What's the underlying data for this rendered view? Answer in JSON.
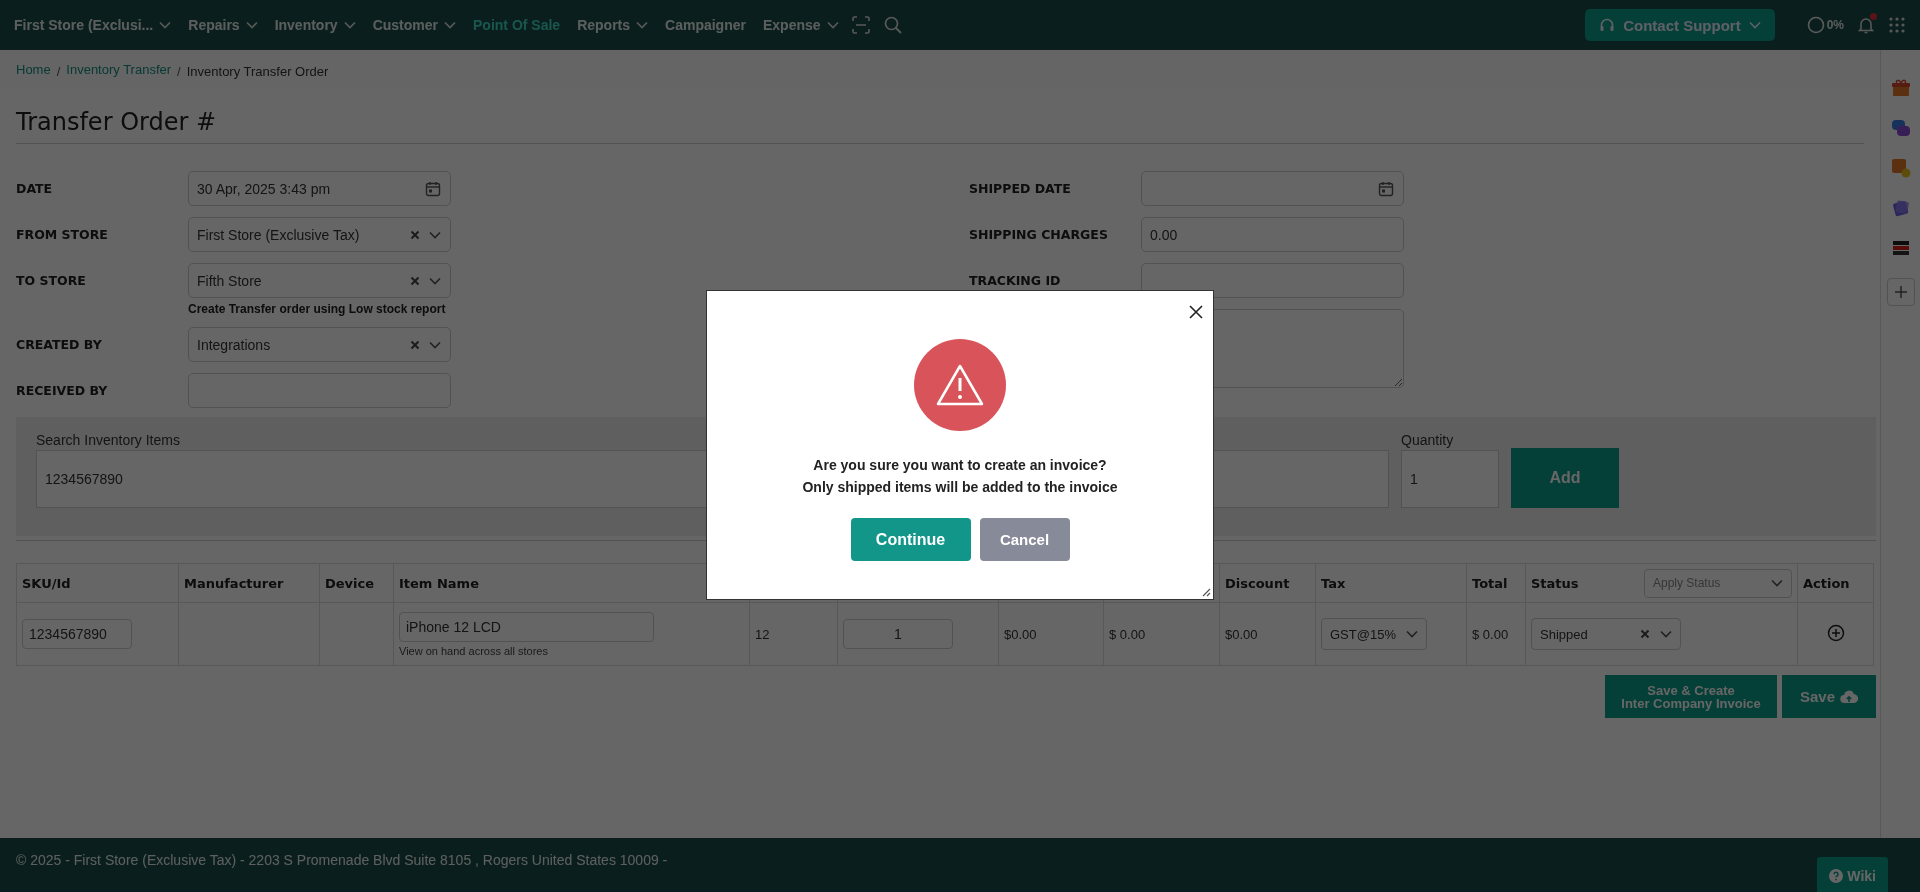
{
  "topbar": {
    "nav": [
      {
        "label": "First Store (Exclusi...",
        "dropdown": true,
        "selected": false
      },
      {
        "label": "Repairs",
        "dropdown": true,
        "selected": false
      },
      {
        "label": "Inventory",
        "dropdown": true,
        "selected": false
      },
      {
        "label": "Customer",
        "dropdown": true,
        "selected": false
      },
      {
        "label": "Point Of Sale",
        "dropdown": false,
        "selected": true
      },
      {
        "label": "Reports",
        "dropdown": true,
        "selected": false
      },
      {
        "label": "Campaigner",
        "dropdown": false,
        "selected": false
      },
      {
        "label": "Expense",
        "dropdown": true,
        "selected": false
      }
    ],
    "contact_support": "Contact Support",
    "progress": "0%",
    "notification": true
  },
  "breadcrumb": {
    "separator": "/",
    "items": [
      {
        "label": "Home",
        "kind": "link"
      },
      {
        "label": "Inventory Transfer",
        "kind": "link"
      },
      {
        "label": "Inventory Transfer Order",
        "kind": "current"
      }
    ]
  },
  "title": "Transfer Order #",
  "left_fields": [
    {
      "label": "DATE",
      "kind": "date",
      "value": "30 Apr, 2025  3:43 pm"
    },
    {
      "label": "FROM STORE",
      "kind": "select",
      "value": "First Store (Exclusive Tax)"
    },
    {
      "label": "TO STORE",
      "kind": "select",
      "value": "Fifth Store",
      "hint": "Create Transfer order using Low stock report"
    },
    {
      "label": "CREATED BY",
      "kind": "select",
      "value": "Integrations"
    },
    {
      "label": "RECEIVED BY",
      "kind": "text"
    }
  ],
  "right_fields": [
    {
      "label": "SHIPPED DATE",
      "kind": "date"
    },
    {
      "label": "SHIPPING CHARGES",
      "kind": "text",
      "value": "0.00"
    },
    {
      "label": "TRACKING ID",
      "kind": "text"
    },
    {
      "kind": "textarea"
    }
  ],
  "search": {
    "label": "Search Inventory Items",
    "value": "1234567890",
    "quantity_label": "Quantity",
    "quantity": "1",
    "add_button": "Add"
  },
  "table": {
    "columns": [
      "SKU/Id",
      "Manufacturer",
      "Device",
      "Item Name",
      null,
      null,
      null,
      null,
      "Discount",
      "Tax",
      "Total",
      "Status",
      "Action"
    ],
    "apply_status": "Apply Status",
    "rows": [
      {
        "cells": [
          {
            "kind": "input",
            "value": "1234567890"
          },
          {
            "kind": "empty"
          },
          {
            "kind": "empty"
          },
          {
            "kind": "item",
            "value": "iPhone 12 LCD",
            "link": "View on hand across all stores"
          },
          {
            "kind": "text",
            "value": "12"
          },
          {
            "kind": "qty",
            "value": "1"
          },
          {
            "kind": "text",
            "value": "$0.00"
          },
          {
            "kind": "text",
            "value": "$ 0.00"
          },
          {
            "kind": "text",
            "value": "$0.00"
          },
          {
            "kind": "select",
            "value": "GST@15%"
          },
          {
            "kind": "text",
            "value": "$ 0.00"
          },
          {
            "kind": "status",
            "value": "Shipped"
          },
          {
            "kind": "action"
          }
        ]
      }
    ]
  },
  "buttons": [
    {
      "label": "Save & Create\nInter Company Invoice",
      "kind": "secondary"
    },
    {
      "label": "Save",
      "kind": "save"
    }
  ],
  "footer": {
    "text": "© 2025 - First Store (Exclusive Tax) - 2203 S Promenade Blvd Suite 8105 , Rogers United States 10009 -",
    "wiki": "Wiki"
  },
  "dialog": {
    "messages": [
      "Are you sure you want to create an invoice?",
      "Only shipped items will be added to the invoice"
    ],
    "buttons": [
      {
        "label": "Continue",
        "kind": "primary"
      },
      {
        "label": "Cancel",
        "kind": "secondary"
      }
    ]
  }
}
